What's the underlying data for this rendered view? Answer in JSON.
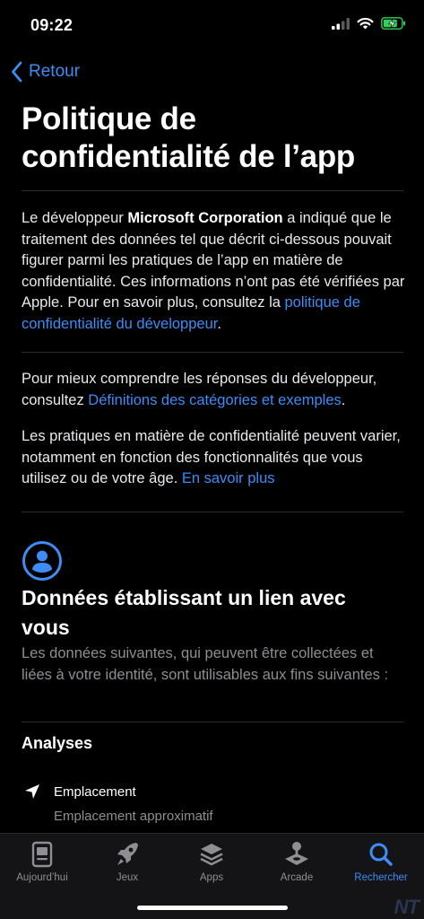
{
  "status_bar": {
    "time": "09:22"
  },
  "nav": {
    "back_label": "Retour"
  },
  "page": {
    "title": "Politique de confidentialité de l’app"
  },
  "intro": {
    "part1": "Le développeur ",
    "developer": "Microsoft Corporation",
    "part2": " a indiqué que le traitement des données tel que décrit ci-dessous pouvait figurer parmi les pratiques de l’app en matière de confidentialité. Ces informations n’ont pas été vérifiées par Apple. Pour en savoir plus, consultez la ",
    "link": "politique de confidentialité du développeur",
    "end": "."
  },
  "understand": {
    "part1": "Pour mieux comprendre les réponses du développeur, consultez ",
    "link": "Définitions des catégories et exemples",
    "end": "."
  },
  "practices": {
    "text": "Les pratiques en matière de confidentialité peuvent varier, notamment en fonction des fonctionnalités que vous utilisez ou de votre âge. ",
    "link": "En savoir plus"
  },
  "section": {
    "title": "Données établissant un lien avec vous",
    "description": "Les données suivantes, qui peuvent être collectées et liées à votre identité, sont utilisables aux fins suivantes :"
  },
  "analyses": {
    "title": "Analyses",
    "items": [
      {
        "label": "Emplacement",
        "sublabel": "Emplacement approximatif",
        "icon": "location-arrow-icon"
      }
    ]
  },
  "tab_bar": {
    "tabs": [
      {
        "label": "Aujourd’hui",
        "icon": "today-icon",
        "active": false
      },
      {
        "label": "Jeux",
        "icon": "rocket-icon",
        "active": false
      },
      {
        "label": "Apps",
        "icon": "apps-stack-icon",
        "active": false
      },
      {
        "label": "Arcade",
        "icon": "joystick-icon",
        "active": false
      },
      {
        "label": "Rechercher",
        "icon": "search-icon",
        "active": true
      }
    ]
  },
  "watermark": "NT",
  "colors": {
    "accent": "#3e8cf5",
    "background": "#000000",
    "secondary_text": "#8e8e93",
    "battery": "#30d158"
  }
}
